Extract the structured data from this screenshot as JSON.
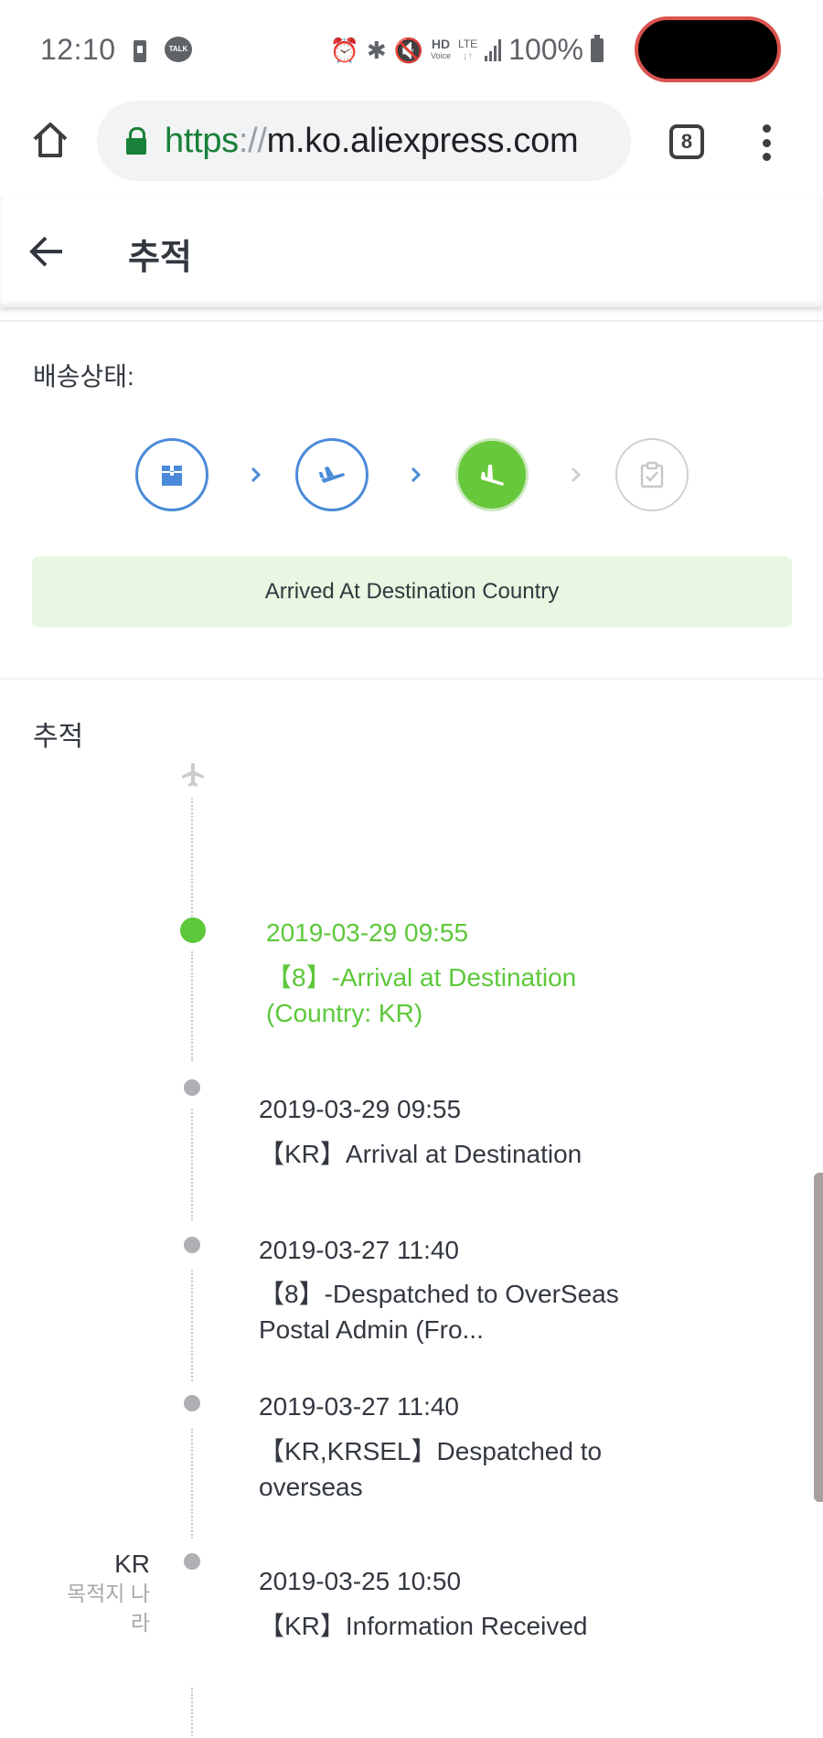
{
  "status_bar": {
    "time": "12:10",
    "left_icons": [
      "sim-icon",
      "kakaotalk-icon"
    ],
    "talk_label": "TALK",
    "right_icons": [
      "alarm-icon",
      "bluetooth-icon",
      "vibrate-icon",
      "hd-voice-icon",
      "lte-icon",
      "signal-icon",
      "battery-icon"
    ],
    "hd_label": "HD",
    "hd_sub": "Voice",
    "lte_label": "LTE",
    "lte_sub": "↓↑",
    "battery": "100%"
  },
  "browser": {
    "url_scheme": "https",
    "url_sep": "://",
    "url_host": "m.ko.aliexpress.com",
    "tab_count": "8"
  },
  "header": {
    "title": "추적"
  },
  "delivery": {
    "label": "배송상태:",
    "steps": [
      {
        "name": "shipped",
        "state": "done",
        "icon": "package-icon"
      },
      {
        "name": "departed",
        "state": "done",
        "icon": "plane-takeoff-icon"
      },
      {
        "name": "arrived",
        "state": "current",
        "icon": "plane-landing-icon"
      },
      {
        "name": "delivered",
        "state": "pending",
        "icon": "clipboard-check-icon"
      }
    ],
    "current_status": "Arrived At Destination Country",
    "colors": {
      "done": "#4a8ad8",
      "current": "#66c83a",
      "pending": "#d0d0d0",
      "banner_bg": "#e7f7e1"
    }
  },
  "tracking": {
    "title": "추적",
    "events": [
      {
        "time": "2019-03-29 09:55",
        "desc": "【8】-Arrival at Destination (Country: KR)",
        "active": true
      },
      {
        "time": "2019-03-29 09:55",
        "desc": "【KR】Arrival at Destination",
        "active": false
      },
      {
        "time": "2019-03-27 11:40",
        "desc": "【8】-Despatched to OverSeas Postal Admin (Fro...",
        "active": false
      },
      {
        "time": "2019-03-27 11:40",
        "desc": "【KR,KRSEL】Despatched  to overseas",
        "active": false
      },
      {
        "time": "2019-03-25 10:50",
        "desc": "【KR】Information Received",
        "active": false,
        "location_code": "KR",
        "location_name": "목적지 나라"
      }
    ]
  }
}
